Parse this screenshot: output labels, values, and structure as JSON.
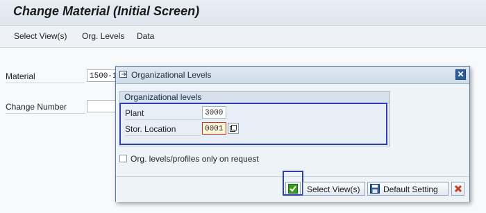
{
  "window": {
    "title": "Change Material (Initial Screen)"
  },
  "menubar": {
    "items": [
      "Select View(s)",
      "Org. Levels",
      "Data"
    ]
  },
  "main": {
    "material_label": "Material",
    "material_value": "1500-1",
    "change_number_label": "Change Number",
    "change_number_value": ""
  },
  "dialog": {
    "title": "Organizational Levels",
    "group_title": "Organizational levels",
    "plant_label": "Plant",
    "plant_value": "3000",
    "stor_location_label": "Stor. Location",
    "stor_location_value": "0001",
    "checkbox_label": "Org. levels/profiles only on request",
    "checkbox_checked": false,
    "buttons": {
      "confirm": "",
      "select_views": "Select View(s)",
      "default_setting": "Default Setting",
      "cancel": ""
    }
  },
  "colors": {
    "highlight": "#2f3fb0",
    "confirm_green": "#3c9a1e",
    "cancel_red": "#d03a1c",
    "dialog_header": "#cfdcea"
  },
  "icons": [
    "dialog-window-icon",
    "close-icon",
    "possible-entries-icon",
    "check-icon",
    "save-icon",
    "cancel-icon"
  ]
}
